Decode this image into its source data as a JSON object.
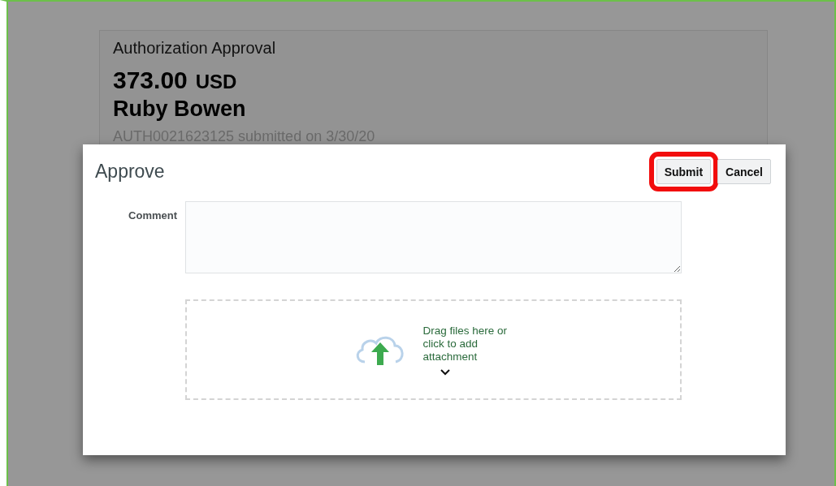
{
  "background_card": {
    "title": "Authorization Approval",
    "amount": "373.00",
    "currency": "USD",
    "name": "Ruby Bowen",
    "reference": "AUTH0021623125 submitted on 3/30/20"
  },
  "dialog": {
    "title": "Approve",
    "buttons": [
      {
        "label": "Submit",
        "highlighted": true
      },
      {
        "label": "Cancel",
        "highlighted": false
      }
    ],
    "comment": {
      "label": "Comment"
    },
    "attachment": {
      "text": "Drag files here or click to add attachment"
    }
  }
}
